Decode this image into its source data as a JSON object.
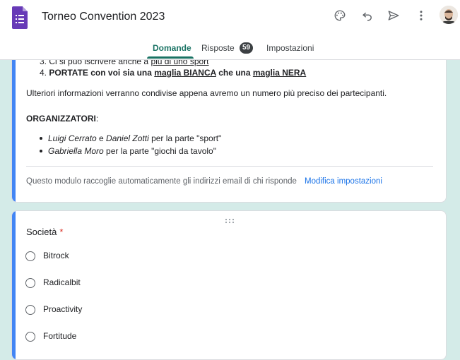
{
  "header": {
    "title": "Torneo Convention 2023",
    "icons": [
      "palette-icon",
      "undo-icon",
      "send-icon",
      "more-vert-icon",
      "avatar"
    ],
    "tabs": [
      {
        "label": "Domande",
        "active": true
      },
      {
        "label": "Risposte",
        "badge": "59"
      },
      {
        "label": "Impostazioni"
      }
    ],
    "accent_color": "#1a7364",
    "brand_color": "#673ab7"
  },
  "description_card": {
    "item3": {
      "number": "3.",
      "text": "Ci si può iscrivere anche a ",
      "link": "più di uno sport"
    },
    "item4": {
      "number": "4.",
      "part1": "PORTATE con voi sia una ",
      "shirt1": "maglia BIANCA",
      "part2": " che una ",
      "shirt2": "maglia NERA"
    },
    "info": "Ulteriori informazioni verranno condivise appena avremo un numero più preciso dei partecipanti.",
    "organizers_label": "ORGANIZZATORI",
    "organizers_colon": ":",
    "organizers": [
      {
        "name1": "Luigi Cerrato",
        "join": " e ",
        "name2": "Daniel Zotti",
        "role": " per la parte \"sport\""
      },
      {
        "name1": "Gabriella Moro",
        "role": " per la parte \"giochi da tavolo\""
      }
    ],
    "email_notice": "Questo modulo raccoglie automaticamente gli indirizzi email di chi risponde",
    "settings_link": "Modifica impostazioni"
  },
  "question_card": {
    "title": "Società",
    "required_mark": "*",
    "options": [
      "Bitrock",
      "Radicalbit",
      "Proactivity",
      "Fortitude"
    ]
  }
}
